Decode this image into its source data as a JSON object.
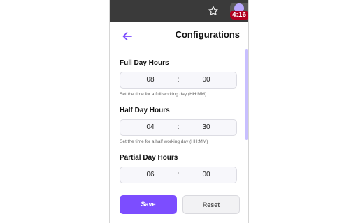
{
  "toolbar": {
    "star_icon": "star-outline-icon",
    "extension_badge": "4:16",
    "badge_color": "#b00020"
  },
  "header": {
    "back_icon": "arrow-left-icon",
    "title": "Configurations",
    "accent_color": "#7c4dff"
  },
  "fields": [
    {
      "label": "Full Day Hours",
      "hours": "08",
      "separator": ":",
      "minutes": "00",
      "helper": "Set the time for a full working day (HH:MM)"
    },
    {
      "label": "Half Day Hours",
      "hours": "04",
      "separator": ":",
      "minutes": "30",
      "helper": "Set the time for a half working day (HH:MM)"
    },
    {
      "label": "Partial Day Hours",
      "hours": "06",
      "separator": ":",
      "minutes": "00"
    }
  ],
  "footer": {
    "save_label": "Save",
    "reset_label": "Reset"
  }
}
